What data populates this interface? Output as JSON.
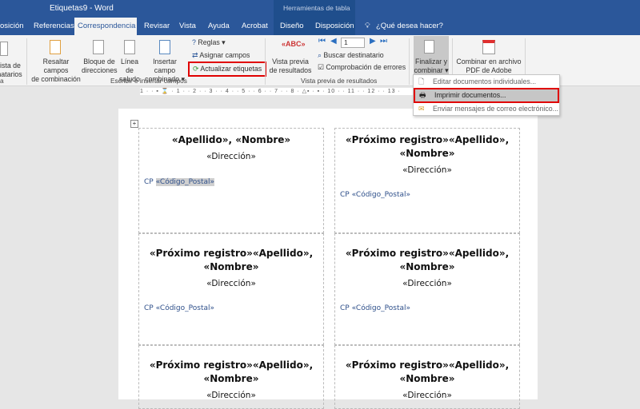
{
  "window": {
    "title": "Etiquetas9  -  Word",
    "context_tools": "Herramientas de tabla"
  },
  "tabs": [
    {
      "label": "osición"
    },
    {
      "label": "Referencias"
    },
    {
      "label": "Correspondencia"
    },
    {
      "label": "Revisar"
    },
    {
      "label": "Vista"
    },
    {
      "label": "Ayuda"
    },
    {
      "label": "Acrobat"
    },
    {
      "label": "Diseño"
    },
    {
      "label": "Disposición"
    }
  ],
  "tell_me": "¿Qué desea hacer?",
  "ribbon": {
    "lista": [
      "lista de",
      "natarios"
    ],
    "resaltar": [
      "Resaltar campos",
      "de combinación"
    ],
    "bloque": [
      "Bloque de",
      "direcciones"
    ],
    "linea": [
      "Línea de",
      "saludo"
    ],
    "insertar": [
      "Insertar campo",
      "combinado ▾"
    ],
    "reglas": "Reglas ▾",
    "asignar": "Asignar campos",
    "actualizar": "Actualizar etiquetas",
    "group_left": "a",
    "group_escribir": "Escribir e insertar campos",
    "vista_previa": [
      "Vista previa",
      "de resultados"
    ],
    "record": "1",
    "buscar": "Buscar destinatario",
    "comprobacion": "Comprobación de errores",
    "group_vista": "Vista previa de resultados",
    "finalizar": [
      "Finalizar y",
      "combinar ▾"
    ],
    "combinar_pdf": [
      "Combinar en archivo",
      "PDF de Adobe"
    ]
  },
  "ruler": "1 · · ▪ ⌛ · 1 · · 2 · · 3 · · 4 · · 5 · · 6 · · 7 · · 8 · △▪ · ▪ · 10 · · 11 · · 12 · · 13 ·",
  "menu": [
    {
      "label": "Editar documentos individuales..."
    },
    {
      "label": "Imprimir documentos..."
    },
    {
      "label": "Enviar mensajes de correo electrónico..."
    }
  ],
  "labels": [
    {
      "name": [
        "«Apellido», «Nombre»"
      ],
      "dir": "«Dirección»",
      "cp_prefix": "CP ",
      "cp": "«Código_Postal»"
    },
    {
      "name": [
        "«Próximo registro»«Apellido»,",
        "«Nombre»"
      ],
      "dir": "«Dirección»",
      "cp_prefix": "CP ",
      "cp": "«Código_Postal»"
    },
    {
      "name": [
        "«Próximo registro»«Apellido»,",
        "«Nombre»"
      ],
      "dir": "«Dirección»",
      "cp_prefix": "CP ",
      "cp": "«Código_Postal»"
    },
    {
      "name": [
        "«Próximo registro»«Apellido»,",
        "«Nombre»"
      ],
      "dir": "«Dirección»",
      "cp_prefix": "CP ",
      "cp": "«Código_Postal»"
    },
    {
      "name": [
        "«Próximo registro»«Apellido»,",
        "«Nombre»"
      ],
      "dir": "«Dirección»"
    },
    {
      "name": [
        "«Próximo registro»«Apellido»,",
        "«Nombre»"
      ],
      "dir": "«Dirección»"
    }
  ]
}
